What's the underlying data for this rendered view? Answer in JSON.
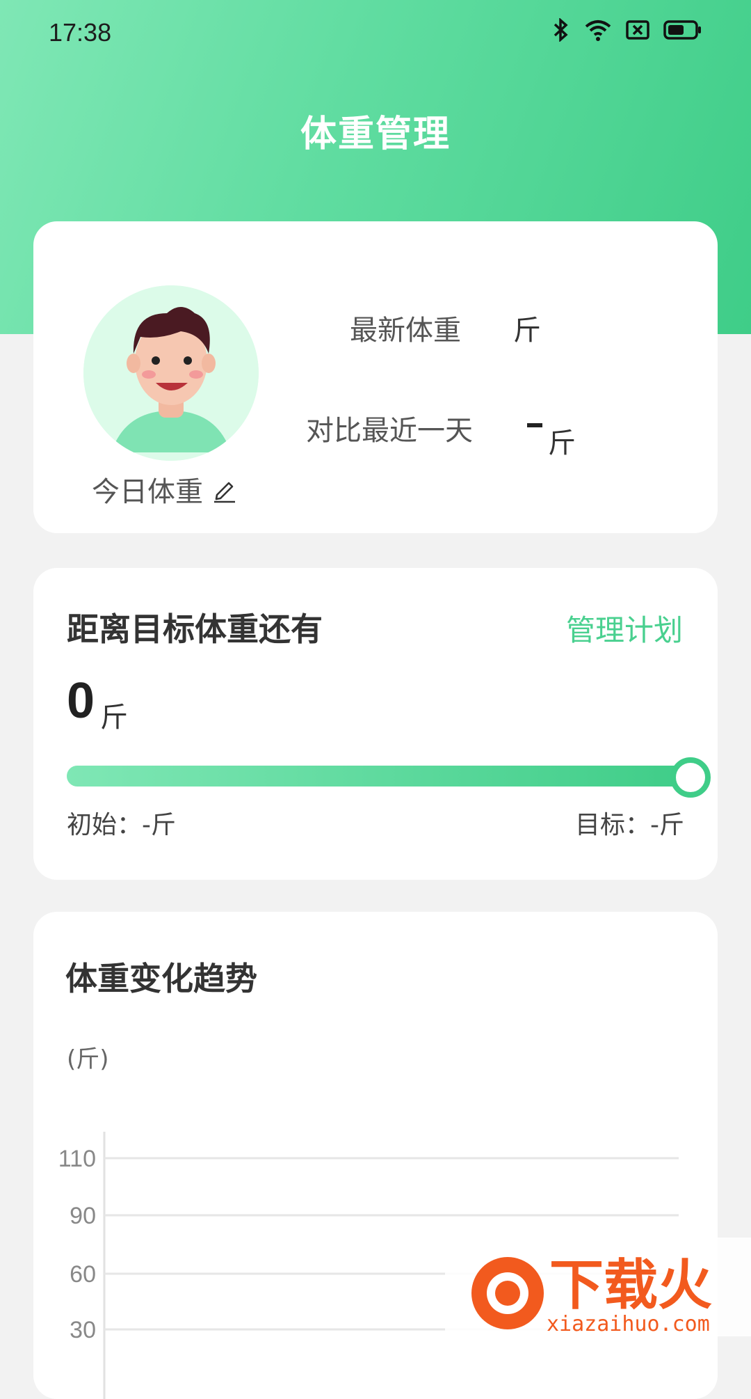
{
  "status": {
    "time": "17:38",
    "icons": [
      "bluetooth-icon",
      "wifi-icon",
      "sim-x-icon",
      "battery-icon"
    ]
  },
  "header": {
    "title": "体重管理"
  },
  "profile": {
    "today_label": "今日体重",
    "latest_label": "最新体重",
    "latest_unit": "斤",
    "compare_label": "对比最近一天",
    "compare_unit": "斤"
  },
  "goal": {
    "title": "距离目标体重还有",
    "manage_label": "管理计划",
    "remaining_value": "0",
    "remaining_unit": "斤",
    "progress": 1.0,
    "initial_text": "初始：-斤",
    "target_text": "目标：-斤"
  },
  "trend": {
    "title": "体重变化趋势",
    "unit_label": "(斤)"
  },
  "chart_data": {
    "type": "line",
    "title": "",
    "xlabel": "",
    "ylabel": "(斤)",
    "yticks": [
      110,
      90,
      60,
      30
    ],
    "series": [],
    "grid": true
  },
  "watermark": {
    "text": "下载火",
    "url_text": "xiazaihuo.com"
  },
  "colors": {
    "accent": "#49d08f",
    "hero_start": "#7fe7b5",
    "hero_end": "#3fcd88"
  }
}
